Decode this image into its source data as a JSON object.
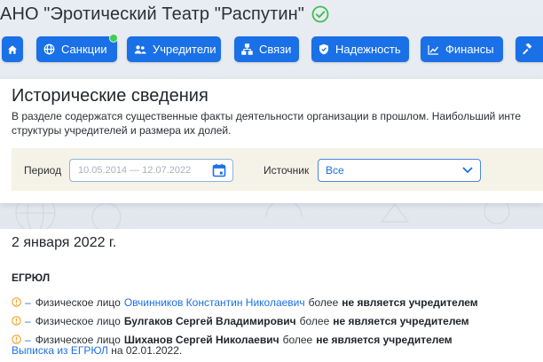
{
  "header": {
    "org_title": "АНО \"Эротический Театр \"Распутин\""
  },
  "nav": [
    {
      "label": "",
      "icon": "home-icon"
    },
    {
      "label": "Санкции",
      "icon": "globe-icon"
    },
    {
      "label": "Учредители",
      "icon": "users-icon"
    },
    {
      "label": "Связи",
      "icon": "network-icon"
    },
    {
      "label": "Надежность",
      "icon": "shield-icon"
    },
    {
      "label": "Финансы",
      "icon": "chart-icon"
    },
    {
      "label": "",
      "icon": "gavel-icon"
    }
  ],
  "history": {
    "title": "Исторические сведения",
    "description": "В разделе содержатся существенные факты деятельности организации в прошлом. Наибольший инте структуры учредителей и размера их долей.",
    "period_label": "Период",
    "period_placeholder": "10.05.2014 — 12.07.2022",
    "source_label": "Источник",
    "source_value": "Все"
  },
  "timeline": {
    "date": "2 января 2022 г.",
    "source_title": "ЕГРЮЛ",
    "events": [
      {
        "prefix": "Физическое лицо",
        "person": "Овчинников Константин Николаевич",
        "link": true,
        "middle": "более",
        "status": "не является учредителем"
      },
      {
        "prefix": "Физическое лицо",
        "person": "Булгаков Сергей Владимирович",
        "link": false,
        "middle": "более",
        "status": "не является учредителем"
      },
      {
        "prefix": "Физическое лицо",
        "person": "Шиханов Сергей Николаевич",
        "link": false,
        "middle": "более",
        "status": "не является учредителем"
      }
    ],
    "extract_link": "Выписка из ЕГРЮЛ",
    "extract_suffix": "на 02.01.2022."
  },
  "colors": {
    "accent": "#1a70e6",
    "verified": "#3fbf4f",
    "warning": "#f0a020",
    "filter_bg": "#f5f2e7"
  }
}
